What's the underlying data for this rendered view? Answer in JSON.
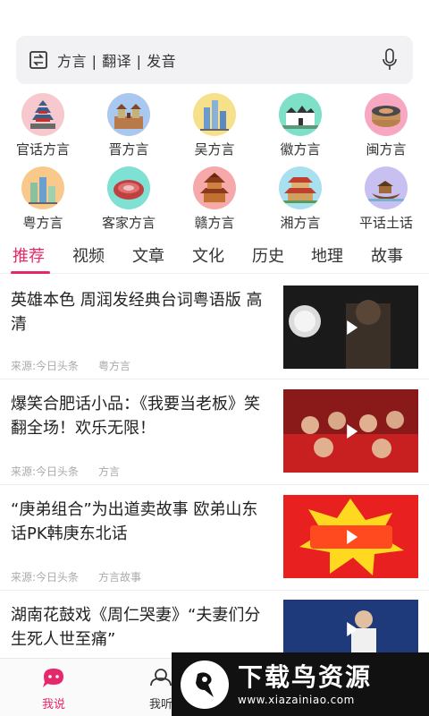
{
  "search": {
    "placeholder": "方言 | 翻译 | 发音",
    "icon_left": "translate-icon",
    "icon_right": "microphone-icon"
  },
  "dialects": [
    {
      "label": "官话方言",
      "color": "#f7c9cf",
      "icon": "temple-of-heaven-icon"
    },
    {
      "label": "晋方言",
      "color": "#a8c8f0",
      "icon": "city-tower-icon"
    },
    {
      "label": "吴方言",
      "color": "#f7e08a",
      "icon": "skyscraper-icon"
    },
    {
      "label": "徽方言",
      "color": "#7fe0c8",
      "icon": "hui-house-icon"
    },
    {
      "label": "闽方言",
      "color": "#f7a8c0",
      "icon": "tulou-icon"
    },
    {
      "label": "粤方言",
      "color": "#f8c98a",
      "icon": "canton-tower-icon"
    },
    {
      "label": "客家方言",
      "color": "#7fe0d4",
      "icon": "round-house-icon"
    },
    {
      "label": "赣方言",
      "color": "#f7a8a8",
      "icon": "pavilion-icon"
    },
    {
      "label": "湘方言",
      "color": "#a8e0f0",
      "icon": "yueyang-tower-icon"
    },
    {
      "label": "平话土话",
      "color": "#c8c0f0",
      "icon": "boat-icon"
    }
  ],
  "tabs": [
    "推荐",
    "视频",
    "文章",
    "文化",
    "历史",
    "地理",
    "故事"
  ],
  "active_tab": "推荐",
  "feed": [
    {
      "title": "英雄本色 周润发经典台词粤语版 高清",
      "source": "来源:今日头条",
      "tag": "粤方言",
      "thumb": "dark-stage"
    },
    {
      "title": "爆笑合肥话小品：《我要当老板》笑翻全场！欢乐无限！",
      "source": "来源:今日头条",
      "tag": "方言",
      "thumb": "audience"
    },
    {
      "title": "“庚弟组合”为出道卖故事 欧弟山东话PK韩庚东北话",
      "source": "来源:今日头条",
      "tag": "方言故事",
      "thumb": "boom"
    },
    {
      "title": "湖南花鼓戏《周仁哭妻》“夫妻们分生死人世至痛”",
      "source": "",
      "tag": "",
      "thumb": "opera"
    }
  ],
  "bottom_nav": [
    {
      "label": "我说",
      "icon": "speech-bubble-icon",
      "active": true
    },
    {
      "label": "我听",
      "icon": "headset-icon",
      "active": false
    }
  ],
  "watermark": {
    "cn": "下载鸟资源",
    "url": "www.xiazainiao.com"
  },
  "colors": {
    "accent": "#e5286b",
    "search_bg": "#f2f2f4",
    "meta": "#aaaaaa"
  }
}
